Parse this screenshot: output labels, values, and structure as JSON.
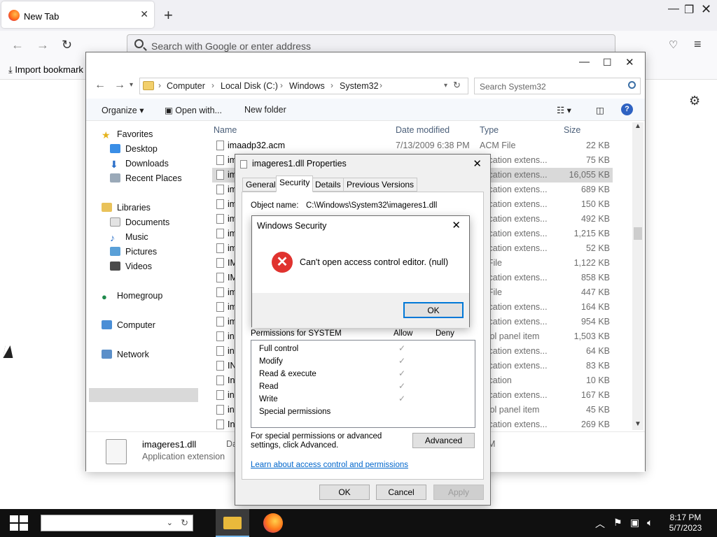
{
  "firefox": {
    "tab_title": "New Tab",
    "url_placeholder": "Search with Google or enter address",
    "bookmark_label": "Import bookmark"
  },
  "explorer": {
    "breadcrumb": [
      "Computer",
      "Local Disk (C:)",
      "Windows",
      "System32"
    ],
    "search_placeholder": "Search System32",
    "toolbar": {
      "organize": "Organize",
      "open_with": "Open with...",
      "new_folder": "New folder"
    },
    "nav": {
      "favorites": "Favorites",
      "desktop": "Desktop",
      "downloads": "Downloads",
      "recent": "Recent Places",
      "libraries": "Libraries",
      "documents": "Documents",
      "music": "Music",
      "pictures": "Pictures",
      "videos": "Videos",
      "homegroup": "Homegroup",
      "computer": "Computer",
      "network": "Network"
    },
    "columns": {
      "name": "Name",
      "date": "Date modified",
      "type": "Type",
      "size": "Size"
    },
    "rows": [
      {
        "name": "imaadp32.acm",
        "date": "7/13/2009 6:38 PM",
        "type": "ACM File",
        "size": "22 KB"
      },
      {
        "name": "im",
        "date": "",
        "type": "plication extens...",
        "size": "75 KB"
      },
      {
        "name": "im",
        "date": "",
        "type": "plication extens...",
        "size": "16,055 KB"
      },
      {
        "name": "im",
        "date": "",
        "type": "plication extens...",
        "size": "689 KB"
      },
      {
        "name": "im",
        "date": "",
        "type": "plication extens...",
        "size": "150 KB"
      },
      {
        "name": "im",
        "date": "",
        "type": "plication extens...",
        "size": "492 KB"
      },
      {
        "name": "im",
        "date": "",
        "type": "plication extens...",
        "size": "1,215 KB"
      },
      {
        "name": "im",
        "date": "",
        "type": "plication extens...",
        "size": "52 KB"
      },
      {
        "name": "IM",
        "date": "",
        "type": "E File",
        "size": "1,122 KB"
      },
      {
        "name": "IM",
        "date": "",
        "type": "plication extens...",
        "size": "858 KB"
      },
      {
        "name": "im",
        "date": "",
        "type": "E File",
        "size": "447 KB"
      },
      {
        "name": "im",
        "date": "",
        "type": "plication extens...",
        "size": "164 KB"
      },
      {
        "name": "im",
        "date": "",
        "type": "plication extens...",
        "size": "954 KB"
      },
      {
        "name": "in",
        "date": "",
        "type": "ntrol panel item",
        "size": "1,503 KB"
      },
      {
        "name": "in",
        "date": "",
        "type": "plication extens...",
        "size": "64 KB"
      },
      {
        "name": "IN",
        "date": "",
        "type": "plication extens...",
        "size": "83 KB"
      },
      {
        "name": "In",
        "date": "",
        "type": "plication",
        "size": "10 KB"
      },
      {
        "name": "in",
        "date": "",
        "type": "plication extens...",
        "size": "167 KB"
      },
      {
        "name": "in",
        "date": "",
        "type": "ntrol panel item",
        "size": "45 KB"
      },
      {
        "name": "In",
        "date": "",
        "type": "plication extens...",
        "size": "269 KB"
      }
    ],
    "details": {
      "name": "imageres1.dll",
      "type": "Application extension",
      "col2": "Da",
      "col3": "M"
    }
  },
  "properties": {
    "title": "imageres1.dll Properties",
    "tabs": [
      "General",
      "Security",
      "Details",
      "Previous Versions"
    ],
    "object_name_label": "Object name:",
    "object_name": "C:\\Windows\\System32\\imageres1.dll",
    "permissions_header": "Permissions for SYSTEM",
    "allow": "Allow",
    "deny": "Deny",
    "permissions": [
      "Full control",
      "Modify",
      "Read & execute",
      "Read",
      "Write",
      "Special permissions"
    ],
    "advanced_text": "For special permissions or advanced settings, click Advanced.",
    "advanced_button": "Advanced",
    "link": "Learn about access control and permissions",
    "ok": "OK",
    "cancel": "Cancel",
    "apply": "Apply"
  },
  "security_dialog": {
    "title": "Windows Security",
    "message": "Can't open access control editor. (null)",
    "ok": "OK"
  },
  "taskbar": {
    "time": "8:17 PM",
    "date": "5/7/2023"
  }
}
